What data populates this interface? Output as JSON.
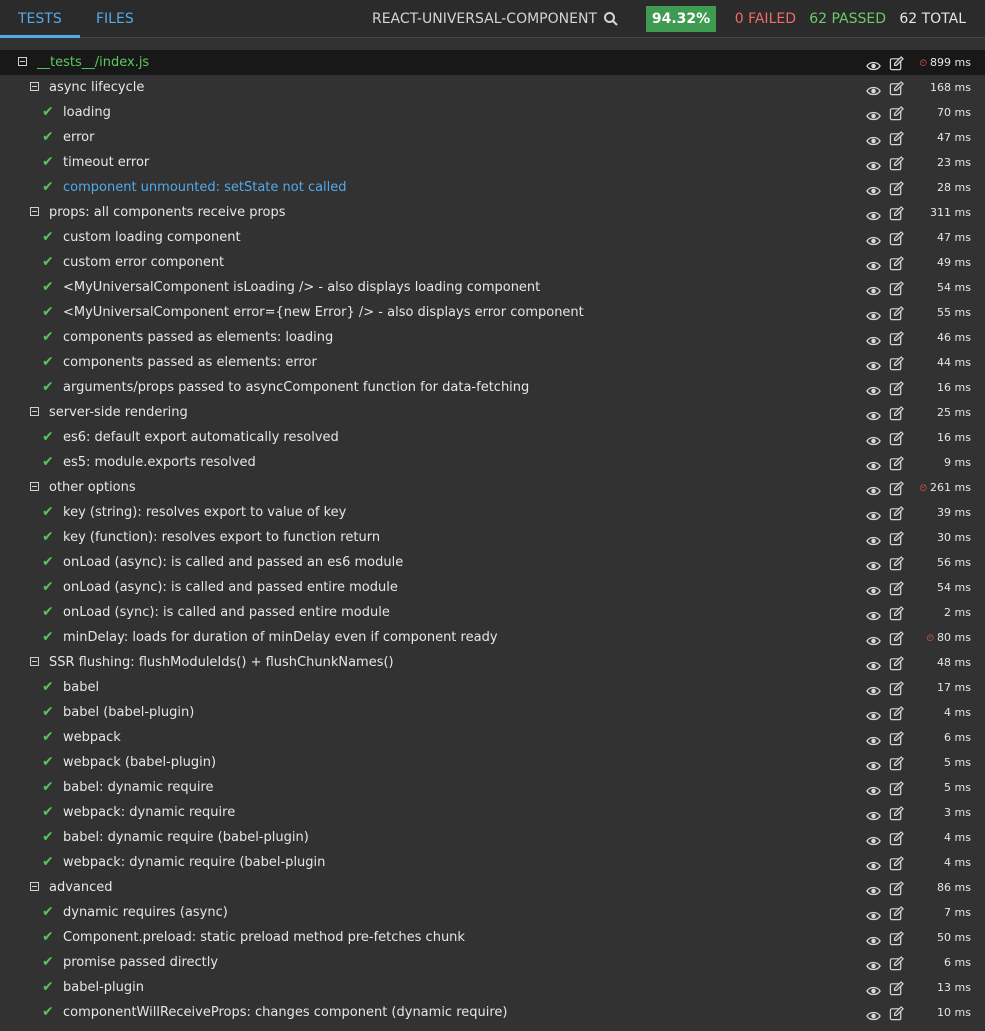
{
  "tabs": {
    "tests": "TESTS",
    "files": "FILES"
  },
  "project": "REACT-UNIVERSAL-COMPONENT",
  "coverage": "94.32%",
  "stats": {
    "failed": "0 FAILED",
    "passed": "62 PASSED",
    "total": "62 TOTAL"
  },
  "rows": [
    {
      "kind": "file",
      "label": "__tests__/index.js",
      "time": "899 ms",
      "slow": true
    },
    {
      "kind": "suite",
      "label": "async lifecycle",
      "time": "168 ms"
    },
    {
      "kind": "test",
      "label": "loading",
      "time": "70 ms"
    },
    {
      "kind": "test",
      "label": "error",
      "time": "47 ms"
    },
    {
      "kind": "test",
      "label": "timeout error",
      "time": "23 ms"
    },
    {
      "kind": "test",
      "label": "component unmounted: setState not called",
      "time": "28 ms",
      "highlight": true
    },
    {
      "kind": "suite",
      "label": "props: all components receive props",
      "time": "311 ms"
    },
    {
      "kind": "test",
      "label": "custom loading component",
      "time": "47 ms"
    },
    {
      "kind": "test",
      "label": "custom error component",
      "time": "49 ms"
    },
    {
      "kind": "test",
      "label": "<MyUniversalComponent isLoading /> - also displays loading component",
      "time": "54 ms"
    },
    {
      "kind": "test",
      "label": "<MyUniversalComponent error={new Error} /> - also displays error component",
      "time": "55 ms"
    },
    {
      "kind": "test",
      "label": "components passed as elements: loading",
      "time": "46 ms"
    },
    {
      "kind": "test",
      "label": "components passed as elements: error",
      "time": "44 ms"
    },
    {
      "kind": "test",
      "label": "arguments/props passed to asyncComponent function for data-fetching",
      "time": "16 ms"
    },
    {
      "kind": "suite",
      "label": "server-side rendering",
      "time": "25 ms"
    },
    {
      "kind": "test",
      "label": "es6: default export automatically resolved",
      "time": "16 ms"
    },
    {
      "kind": "test",
      "label": "es5: module.exports resolved",
      "time": "9 ms"
    },
    {
      "kind": "suite",
      "label": "other options",
      "time": "261 ms",
      "slow": true
    },
    {
      "kind": "test",
      "label": "key (string): resolves export to value of key",
      "time": "39 ms"
    },
    {
      "kind": "test",
      "label": "key (function): resolves export to function return",
      "time": "30 ms"
    },
    {
      "kind": "test",
      "label": "onLoad (async): is called and passed an es6 module",
      "time": "56 ms"
    },
    {
      "kind": "test",
      "label": "onLoad (async): is called and passed entire module",
      "time": "54 ms"
    },
    {
      "kind": "test",
      "label": "onLoad (sync): is called and passed entire module",
      "time": "2 ms"
    },
    {
      "kind": "test",
      "label": "minDelay: loads for duration of minDelay even if component ready",
      "time": "80 ms",
      "slow": true
    },
    {
      "kind": "suite",
      "label": "SSR flushing: flushModuleIds() + flushChunkNames()",
      "time": "48 ms"
    },
    {
      "kind": "test",
      "label": "babel",
      "time": "17 ms"
    },
    {
      "kind": "test",
      "label": "babel (babel-plugin)",
      "time": "4 ms"
    },
    {
      "kind": "test",
      "label": "webpack",
      "time": "6 ms"
    },
    {
      "kind": "test",
      "label": "webpack (babel-plugin)",
      "time": "5 ms"
    },
    {
      "kind": "test",
      "label": "babel: dynamic require",
      "time": "5 ms"
    },
    {
      "kind": "test",
      "label": "webpack: dynamic require",
      "time": "3 ms"
    },
    {
      "kind": "test",
      "label": "babel: dynamic require (babel-plugin)",
      "time": "4 ms"
    },
    {
      "kind": "test",
      "label": "webpack: dynamic require (babel-plugin",
      "time": "4 ms"
    },
    {
      "kind": "suite",
      "label": "advanced",
      "time": "86 ms"
    },
    {
      "kind": "test",
      "label": "dynamic requires (async)",
      "time": "7 ms"
    },
    {
      "kind": "test",
      "label": "Component.preload: static preload method pre-fetches chunk",
      "time": "50 ms"
    },
    {
      "kind": "test",
      "label": "promise passed directly",
      "time": "6 ms"
    },
    {
      "kind": "test",
      "label": "babel-plugin",
      "time": "13 ms"
    },
    {
      "kind": "test",
      "label": "componentWillReceiveProps: changes component (dynamic require)",
      "time": "10 ms"
    }
  ],
  "icons": {
    "search": "search-icon",
    "eye": "eye-icon",
    "edit": "edit-icon",
    "check": "check-icon",
    "collapse": "collapse-icon",
    "clock": "clock-icon"
  }
}
